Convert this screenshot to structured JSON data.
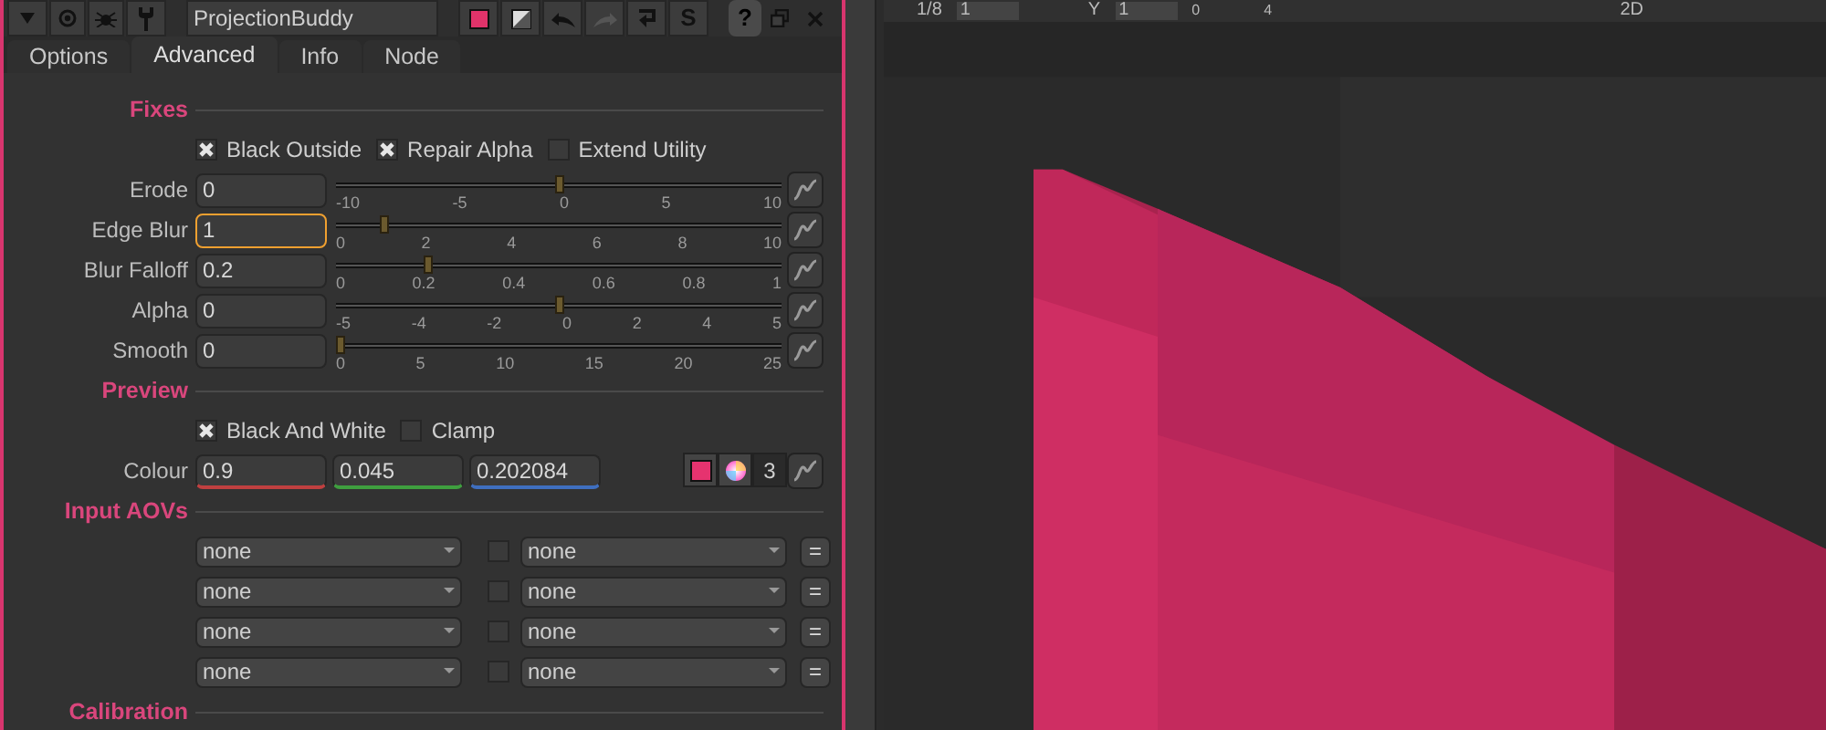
{
  "toolbar": {
    "node_name": "ProjectionBuddy",
    "s_glyph": "S",
    "help_glyph": "?",
    "redo_disabled": true
  },
  "tabs": [
    {
      "label": "Options",
      "selected": false
    },
    {
      "label": "Advanced",
      "selected": true
    },
    {
      "label": "Info",
      "selected": false
    },
    {
      "label": "Node",
      "selected": false
    }
  ],
  "sections": [
    {
      "title": "Fixes",
      "items": [
        {
          "kind": "checks",
          "checks": [
            {
              "label": "Black Outside",
              "checked": true
            },
            {
              "label": "Repair Alpha",
              "checked": true
            },
            {
              "label": "Extend Utility",
              "checked": false
            }
          ]
        },
        {
          "kind": "slider",
          "label": "Erode",
          "value": "0",
          "focused": false,
          "level": 0.5,
          "ticks": [
            "-10",
            "-5",
            "0",
            "5",
            "10"
          ]
        },
        {
          "kind": "slider",
          "label": "Edge Blur",
          "value": "1",
          "focused": true,
          "level": 0.1,
          "ticks": [
            "0",
            "2",
            "4",
            "6",
            "8",
            "10"
          ]
        },
        {
          "kind": "slider",
          "label": "Blur Falloff",
          "value": "0.2",
          "focused": false,
          "level": 0.2,
          "ticks": [
            "0",
            "0.2",
            "0.4",
            "0.6",
            "0.8",
            "1"
          ]
        },
        {
          "kind": "slider",
          "label": "Alpha",
          "value": "0",
          "focused": false,
          "level": 0.5,
          "ticks": [
            "-5",
            "-4",
            "-2",
            "0",
            "2",
            "4",
            "5"
          ]
        },
        {
          "kind": "slider",
          "label": "Smooth",
          "value": "0",
          "focused": false,
          "level": 0,
          "ticks": [
            "0",
            "5",
            "10",
            "15",
            "20",
            "25"
          ]
        }
      ]
    },
    {
      "title": "Preview",
      "items": [
        {
          "kind": "checks",
          "checks": [
            {
              "label": "Black And White",
              "checked": true
            },
            {
              "label": "Clamp",
              "checked": false
            }
          ]
        },
        {
          "kind": "colour",
          "label": "Colour",
          "values": [
            "0.9",
            "0.045",
            "0.202084"
          ],
          "color": "#e6336f",
          "channels": "3"
        }
      ]
    },
    {
      "title": "Input AOVs",
      "items": [
        {
          "kind": "aov",
          "left": "none",
          "right": "none",
          "checked": false,
          "link": "="
        },
        {
          "kind": "aov",
          "left": "none",
          "right": "none",
          "checked": false,
          "link": "="
        },
        {
          "kind": "aov",
          "left": "none",
          "right": "none",
          "checked": false,
          "link": "="
        },
        {
          "kind": "aov",
          "left": "none",
          "right": "none",
          "checked": false,
          "link": "="
        }
      ]
    },
    {
      "title": "Calibration"
    }
  ],
  "viewer": {
    "frame": "1/8",
    "x_field": "1",
    "y_label": "Y",
    "y_field": "1",
    "gain_ticks": [
      "0",
      "4"
    ],
    "view_mode": "2D"
  }
}
